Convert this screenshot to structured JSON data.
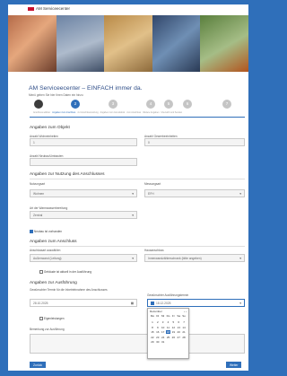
{
  "brand": {
    "name": "AM Serviceecenter"
  },
  "header": {
    "title": "AM Serviceecenter – EINFACH immer da.",
    "subtitle": "Menü geben Sie hier Ihren Daten ein hinzu"
  },
  "steps": {
    "numbers": [
      "",
      "2",
      "3",
      "4",
      "5",
      "6",
      "7"
    ],
    "labels": [
      "Anschluss wählen",
      "Angaben zum Anschluss",
      "zur Anschlussnutzung",
      "Angaben zum Grundstück",
      "zum Anschluss",
      "Weitere Angaben",
      "Übersicht und Senden"
    ]
  },
  "section_object": {
    "heading": "Angaben zum Objekt",
    "label_left": "Anzahl Wohneinheiten",
    "label_right": "Anzahl Gewerbeeinheiten",
    "value_left": "1",
    "value_right": "0",
    "label_extra": "Anzahl Neubau/Umbauten"
  },
  "section_usage": {
    "heading": "Angaben zur Nutzung des Anschlusses",
    "label_left": "Nutzungsart",
    "label_right": "Messungsart",
    "value_left": "Wohnen",
    "value_right": "EFH",
    "label_third": "Art der Warmwasserbereitung",
    "value_third": "Zentral",
    "checkbox_label": "Neubau ist vorhanden"
  },
  "section_connection": {
    "heading": "Angaben zum Anschluss",
    "label_left": "Anschlussart auswählen",
    "label_right": "Hausanschluss",
    "value_left": "Außenwand (Leitung)",
    "value_right": "Innenwandzählerschrank (bitte angeben)",
    "checkbox_label": "Gebäude ist aktuell in der Ausführung"
  },
  "section_execution": {
    "heading": "Angaben zur Ausführung",
    "label_left": "Gewünschter Termin für die Inbetriebnahme des Anschlusses",
    "label_right": "Gewünschter Ausführungstermin",
    "value_left": "28.10.2025",
    "value_right": "18.12.2025",
    "checkbox_label": "Eigenleistungen",
    "label_notes": "Bemerkung zur Ausführung"
  },
  "datepicker": {
    "month": "Dezember",
    "weekdays": [
      "Mo",
      "Di",
      "Mi",
      "Do",
      "Fr",
      "Sa",
      "So"
    ],
    "days": [
      "",
      "",
      "",
      "",
      "",
      "",
      "",
      "1",
      "2",
      "3",
      "4",
      "5",
      "6",
      "7",
      "8",
      "9",
      "10",
      "11",
      "12",
      "13",
      "14",
      "15",
      "16",
      "17",
      "18",
      "19",
      "20",
      "21",
      "22",
      "23",
      "24",
      "25",
      "26",
      "27",
      "28",
      "29",
      "30",
      "31",
      "",
      "",
      "",
      ""
    ],
    "selected": "18"
  },
  "buttons": {
    "back": "Zurück",
    "next": "Weiter"
  }
}
